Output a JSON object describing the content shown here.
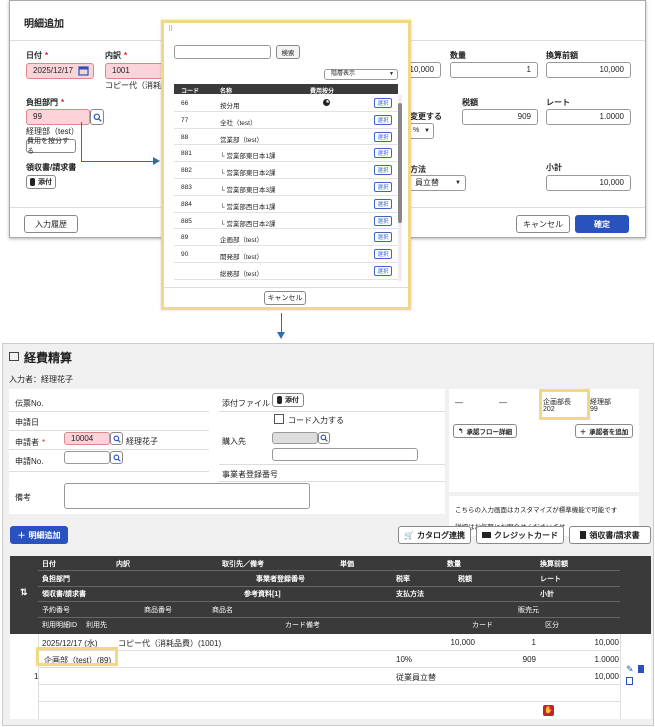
{
  "top_dialog": {
    "title": "明細追加",
    "date": {
      "label": "日付",
      "value": "2025/12/17"
    },
    "breakdown": {
      "label": "内訳",
      "code": "1001",
      "desc": "コピー代（消耗品"
    },
    "dept": {
      "label": "負担部門",
      "code": "99",
      "name": "経理部（test）",
      "allocate_label": "費用を按分する"
    },
    "receipt": {
      "label": "領収書/請求書",
      "attach_label": "添付"
    },
    "quantity": {
      "label": "数量",
      "value": "1"
    },
    "pre_convert": {
      "label": "換算前額",
      "value": "10,000"
    },
    "amount_partial": "10,000",
    "tax_amount": {
      "label": "税額",
      "value": "909"
    },
    "rate": {
      "label": "レート",
      "value": "1.0000"
    },
    "tax_setting_partial": "変更する",
    "tax_select_partial": "%",
    "payment_partial": "方法",
    "payment_value_partial": "員立替",
    "subtotal": {
      "label": "小計",
      "value": "10,000"
    },
    "history_label": "入力履歴",
    "cancel_label": "キャンセル",
    "confirm_label": "確定"
  },
  "popup": {
    "search_label": "検索",
    "display_label": "階層表示",
    "headers": {
      "code": "コード",
      "name": "名称",
      "allocation": "費用按分"
    },
    "rows": [
      {
        "code": "66",
        "name": "按分用",
        "pie": true
      },
      {
        "code": "77",
        "name": "全社（test）",
        "pie": false
      },
      {
        "code": "88",
        "name": "営業部（test）",
        "pie": false
      },
      {
        "code": "881",
        "name": "└ 営業部東日本1課",
        "pie": false
      },
      {
        "code": "882",
        "name": "└ 営業部東日本2課",
        "pie": false
      },
      {
        "code": "883",
        "name": "└ 営業部東日本3課",
        "pie": false
      },
      {
        "code": "884",
        "name": "└ 営業部西日本1課",
        "pie": false
      },
      {
        "code": "885",
        "name": "└ 営業部西日本2課",
        "pie": false
      },
      {
        "code": "89",
        "name": "企画部（test）",
        "pie": false
      },
      {
        "code": "90",
        "name": "開発部（test）",
        "pie": false
      },
      {
        "code": "",
        "name": "総務部（test）",
        "pie": false
      }
    ],
    "select_label": "選択",
    "cancel_label": "キャンセル"
  },
  "expense": {
    "title": "経費精算",
    "inputter": "入力者：経理花子",
    "slip_no_label": "伝票No.",
    "apply_date_label": "申請日",
    "applicant_label": "申請者",
    "applicant_code": "10004",
    "applicant_name": "経理花子",
    "apply_no_label": "申請No.",
    "attach_file_label": "添付ファイル",
    "attach_label": "添付",
    "code_input_label": "コード入力する",
    "vendor_label": "購入先",
    "business_reg_label": "事業者登録番号",
    "remarks_label": "備考",
    "approval": {
      "dash1": "—",
      "dash2": "—",
      "role": "企画部長",
      "code": "202",
      "dept": "経理部",
      "dept_code": "99"
    },
    "approval_flow_label": "承認フロー詳細",
    "add_approver_label": "承認者を追加",
    "note_line1": "こちらの入力画面はカスタマイズが標準機能で可能です",
    "note_line2": "詳細はお気軽にお問合せくださいませ",
    "add_detail_label": "明細追加",
    "catalog_label": "カタログ連携",
    "credit_label": "クレジットカード",
    "receipt_label": "領収書/請求書"
  },
  "grid": {
    "header_rows": [
      [
        "日付",
        "内訳",
        "取引先／備考",
        "単価",
        "数量",
        "換算前額"
      ],
      [
        "負担部門",
        "事業者登録番号",
        "税率",
        "税額",
        "レート"
      ],
      [
        "領収書/請求書",
        "参考資料[1]",
        "支払方法",
        "小計"
      ],
      [
        "予約番号",
        "商品番号",
        "商品名",
        "販売元"
      ],
      [
        "利用明細ID",
        "利用先",
        "カード備考",
        "カード",
        "区分"
      ]
    ],
    "row_num": "1",
    "date": "2025/12/17 (水)",
    "breakdown": "コピー代（消耗品費）(1001)",
    "unit_price": "10,000",
    "quantity": "1",
    "pre_convert": "10,000",
    "dept": "企画部（test）(89)",
    "tax_rate": "10%",
    "tax_amount": "909",
    "rate": "1.0000",
    "payment": "従業員立替",
    "subtotal": "10,000"
  }
}
